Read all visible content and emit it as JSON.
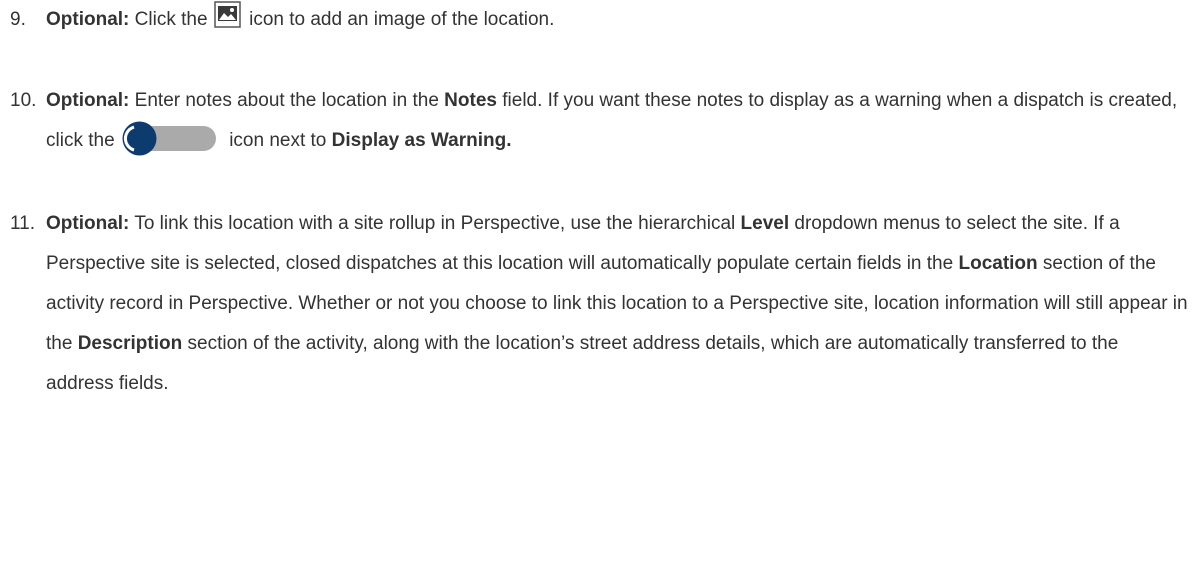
{
  "steps": [
    {
      "number": "9.",
      "optional_label": "Optional:",
      "text_before_icon": " Click the ",
      "icon": "image-icon",
      "text_after_icon": " icon to add an image of the location."
    },
    {
      "number": "10.",
      "optional_label": "Optional:",
      "text_1": " Enter notes about the location in the ",
      "bold_notes": "Notes",
      "text_2": " field. If you want these notes to display as a warning when a dispatch is created, click the ",
      "icon": "toggle-switch-icon",
      "text_3": " icon next to ",
      "bold_display_warning": "Display as Warning."
    },
    {
      "number": "11.",
      "optional_label": "Optional:",
      "text_1": " To link this location with a site rollup in Perspective, use the hierarchical ",
      "bold_level": "Level",
      "text_2": " dropdown menus to select the site. If a Perspective site is selected, closed dispatches at this location will automatically populate certain fields in the ",
      "bold_location": "Location",
      "text_3": " section of the activity record in Perspective. Whether or not you choose to link this location to a Perspective site, location information will still appear in the ",
      "bold_description": "Description",
      "text_4": " section of the activity, along with the location’s street address details, which are automatically transferred to the address fields."
    }
  ],
  "colors": {
    "text": "#333333",
    "toggle_track": "#aaaaaa",
    "toggle_knob": "#0d3b6e"
  }
}
